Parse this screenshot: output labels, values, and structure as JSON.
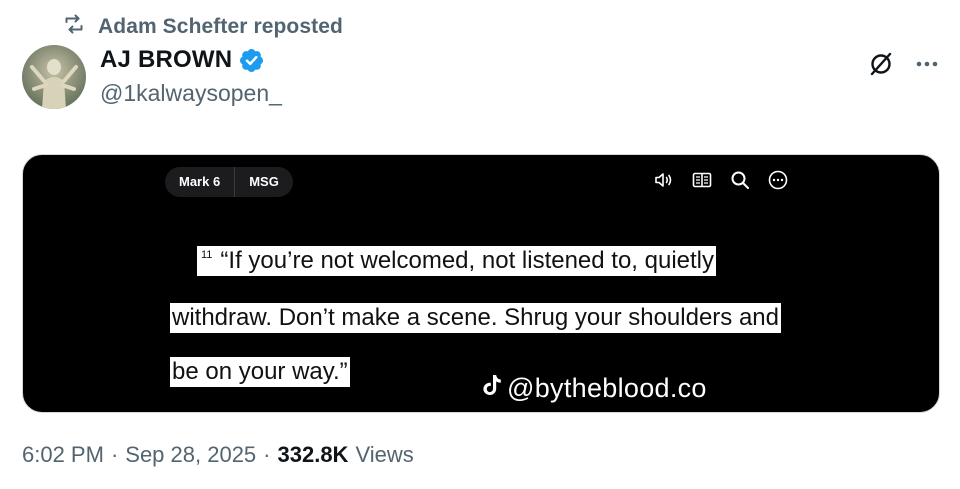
{
  "repost": {
    "text": "Adam Schefter reposted"
  },
  "author": {
    "name": "AJ BROWN",
    "handle": "@1kalwaysopen_",
    "verified": true,
    "verified_color": "#1d9bf0"
  },
  "media": {
    "chips": [
      "Mark 6",
      "MSG"
    ],
    "toolbar_icons": [
      "speaker-icon",
      "book-icon",
      "search-icon",
      "more-circle-icon"
    ],
    "verse_number": "11",
    "lines": [
      "“If you’re not welcomed, not listened to, quietly",
      "withdraw. Don’t make a scene. Shrug your shoulders and",
      "be on your way.”"
    ],
    "watermark": "@bytheblood.co"
  },
  "meta": {
    "time": "6:02 PM",
    "date": "Sep 28, 2025",
    "views_count": "332.8K",
    "views_label": "Views",
    "separator": "·"
  }
}
